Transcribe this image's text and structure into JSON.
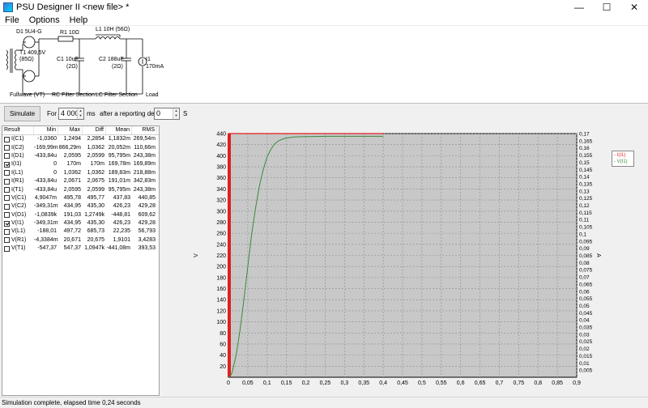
{
  "window": {
    "title": "PSU Designer II  <new file> *",
    "minimize_glyph": "—",
    "maximize_glyph": "☐",
    "close_glyph": "✕"
  },
  "menu": [
    "File",
    "Options",
    "Help"
  ],
  "schematic": {
    "d1_label": "D1 5U4-G",
    "transformer_label": "T1 409,5V",
    "transformer_res": "(85Ω)",
    "r1_label": "R1 10Ω",
    "l1_label": "L1 10H (56Ω)",
    "c1_label": "C1 10uF",
    "c1_res": "(2Ω)",
    "c2_label": "C2 188uF",
    "c2_res": "(2Ω)",
    "i1_label": "I1",
    "i1_value": "170mA",
    "section_rectifier": "Fullwave (VT)",
    "section_rc": "RC Filter Section",
    "section_lc": "LC Filter Section",
    "section_load": "Load"
  },
  "toolbar": {
    "simulate_label": "Simulate",
    "for_label": "For",
    "duration_value": "4 000",
    "ms_label": "ms",
    "delay_label": "after a reporting delay of",
    "delay_value": "0",
    "s_label": "S"
  },
  "results": {
    "headers": [
      "Result",
      "Min",
      "Max",
      "Diff",
      "Mean",
      "RMS"
    ],
    "rows": [
      {
        "name": "I(C1)",
        "checked": false,
        "min": "-1,0360",
        "max": "1,2494",
        "diff": "2,2854",
        "mean": "1,1832m",
        "rms": "269,54m"
      },
      {
        "name": "I(C2)",
        "checked": false,
        "min": "-169,99m",
        "max": "866,29m",
        "diff": "1,0362",
        "mean": "20,052m",
        "rms": "110,66m"
      },
      {
        "name": "I(D1)",
        "checked": false,
        "min": "-433,84u",
        "max": "2,0595",
        "diff": "2,0599",
        "mean": "95,795m",
        "rms": "243,38m"
      },
      {
        "name": "I(I1)",
        "checked": true,
        "min": "0",
        "max": "170m",
        "diff": "170m",
        "mean": "169,78m",
        "rms": "169,89m"
      },
      {
        "name": "I(L1)",
        "checked": false,
        "min": "0",
        "max": "1,0362",
        "diff": "1,0362",
        "mean": "189,83m",
        "rms": "218,88m"
      },
      {
        "name": "I(R1)",
        "checked": false,
        "min": "-433,84u",
        "max": "2,0671",
        "diff": "2,0675",
        "mean": "191,01m",
        "rms": "342,83m"
      },
      {
        "name": "I(T1)",
        "checked": false,
        "min": "-433,84u",
        "max": "2,0595",
        "diff": "2,0599",
        "mean": "95,795m",
        "rms": "243,38m"
      },
      {
        "name": "V(C1)",
        "checked": false,
        "min": "4,9047m",
        "max": "495,78",
        "diff": "495,77",
        "mean": "437,83",
        "rms": "440,85"
      },
      {
        "name": "V(C2)",
        "checked": false,
        "min": "-349,31m",
        "max": "434,95",
        "diff": "435,30",
        "mean": "426,23",
        "rms": "429,28"
      },
      {
        "name": "V(D1)",
        "checked": false,
        "min": "-1,0839k",
        "max": "191,03",
        "diff": "1,2749k",
        "mean": "-448,81",
        "rms": "609,62"
      },
      {
        "name": "V(I1)",
        "checked": true,
        "min": "-349,31m",
        "max": "434,95",
        "diff": "435,30",
        "mean": "426,23",
        "rms": "429,28"
      },
      {
        "name": "V(L1)",
        "checked": false,
        "min": "-188,01",
        "max": "497,72",
        "diff": "685,73",
        "mean": "22,235",
        "rms": "56,793"
      },
      {
        "name": "V(R1)",
        "checked": false,
        "min": "-4,3384m",
        "max": "20,671",
        "diff": "20,675",
        "mean": "1,9101",
        "rms": "3,4283"
      },
      {
        "name": "V(T1)",
        "checked": false,
        "min": "-547,37",
        "max": "547,37",
        "diff": "1,0947k",
        "mean": "-441,08m",
        "rms": "393,53"
      }
    ]
  },
  "legend": [
    "- I(I1)",
    "- V(I1)"
  ],
  "status": "Simulation complete, elapsed time 0,24 seconds",
  "colors": {
    "current_trace": "#e02020",
    "voltage_trace": "#3a8a3a",
    "plot_bg": "#c8c8c8"
  },
  "chart_data": {
    "type": "line",
    "xlabel": "",
    "ylabel": "V",
    "y2label": "A",
    "xlim": [
      0,
      0.9
    ],
    "ylim": [
      0,
      440
    ],
    "y2lim": [
      0,
      0.17
    ],
    "x_ticks": [
      "0",
      "0,05",
      "0,1",
      "0,15",
      "0,2",
      "0,25",
      "0,3",
      "0,35",
      "0,4",
      "0,45",
      "0,5",
      "0,55",
      "0,6",
      "0,65",
      "0,7",
      "0,75",
      "0,8",
      "0,85",
      "0,9"
    ],
    "y_ticks": [
      "20",
      "40",
      "60",
      "80",
      "100",
      "120",
      "140",
      "160",
      "180",
      "200",
      "220",
      "240",
      "260",
      "280",
      "300",
      "320",
      "340",
      "360",
      "380",
      "400",
      "420",
      "440"
    ],
    "y2_ticks": [
      "0,005",
      "0,01",
      "0,015",
      "0,02",
      "0,025",
      "0,03",
      "0,035",
      "0,04",
      "0,045",
      "0,05",
      "0,055",
      "0,06",
      "0,065",
      "0,07",
      "0,075",
      "0,08",
      "0,085",
      "0,09",
      "0,095",
      "0,1",
      "0,105",
      "0,11",
      "0,115",
      "0,12",
      "0,125",
      "0,13",
      "0,135",
      "0,14",
      "0,145",
      "0,15",
      "0,155",
      "0,16",
      "0,165",
      "0,17"
    ],
    "grid": true,
    "series": [
      {
        "name": "I(I1)",
        "axis": "y2",
        "x": [
          0,
          0.0005,
          0.001,
          0.002,
          0.005,
          0.05,
          0.1,
          0.2,
          0.4
        ],
        "y": [
          0,
          0.17,
          0.17,
          0.17,
          0.17,
          0.17,
          0.17,
          0.17,
          0.17
        ]
      },
      {
        "name": "V(I1)",
        "axis": "y",
        "x": [
          0,
          0.005,
          0.01,
          0.02,
          0.03,
          0.04,
          0.05,
          0.06,
          0.07,
          0.08,
          0.09,
          0.1,
          0.11,
          0.12,
          0.13,
          0.14,
          0.15,
          0.17,
          0.2,
          0.25,
          0.3,
          0.4
        ],
        "y": [
          0,
          2,
          10,
          40,
          85,
          140,
          200,
          258,
          305,
          345,
          375,
          398,
          412,
          422,
          427,
          430,
          432,
          434,
          434.5,
          435,
          435,
          435
        ]
      }
    ]
  }
}
